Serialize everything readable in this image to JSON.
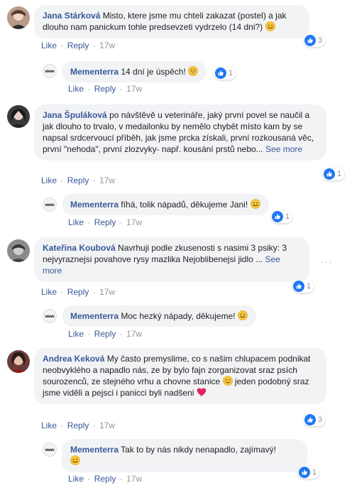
{
  "actions": {
    "like": "Like",
    "reply": "Reply",
    "sep": "·"
  },
  "comments": [
    {
      "author": "Jana Stárková",
      "text": "Misto, ktere jsme mu chteli zakazat (postel) a jak dlouho nam panickum tohle predsevzeti vydrzelo (14 dni?)",
      "time": "17w",
      "reactions": "3",
      "reply": {
        "author": "Mementerra",
        "text": "14 dní je úspěch!",
        "time": "17w",
        "reactions": "1"
      }
    },
    {
      "author": "Jana Špuláková",
      "text": "po návštěvě u veterináře, jaký první povel se naučil a jak dlouho to trvalo, v medailonku by nemělo chybět místo kam by se napsal srdcervoucí příběh, jak jsme prcka získali, první rozkousaná věc, první \"nehoda\", první zlozvyky- např. kousání prstů nebo...",
      "see_more": "See more",
      "time": "17w",
      "reactions": "1",
      "reply": {
        "author": "Mementerra",
        "text": "fíhá, tolik nápadů, děkujeme Jani!",
        "time": "17w",
        "reactions": "1"
      }
    },
    {
      "author": "Kateřina Koubová",
      "text": "Navrhuji podle zkusenosti s nasimi 3 psiky: 3 nejvyraznejsi povahove rysy mazlika Nejoblibenejsi jidlo ...",
      "see_more": "See more",
      "time": "17w",
      "reactions": "1",
      "more": "···",
      "reply": {
        "author": "Mementerra",
        "text": "Moc hezký nápady, děkujeme!",
        "time": "17w"
      }
    },
    {
      "author": "Andrea Keková",
      "text": "My často premyslime, co s našim chlupacem podnikat neobvyklého a napadlo nás, ze by bylo fajn zorganizovat sraz psích sourozenců, ze stejného vrhu a chovne stanice",
      "text2": "jeden podobný sraz jsme viděli a pejsci i panicci byli nadšeni",
      "time": "17w",
      "reactions": "3",
      "reply": {
        "author": "Mementerra",
        "text": "Tak to by nás nikdy nenapadlo, zajímavý!",
        "time": "17w",
        "reactions": "1"
      }
    }
  ]
}
